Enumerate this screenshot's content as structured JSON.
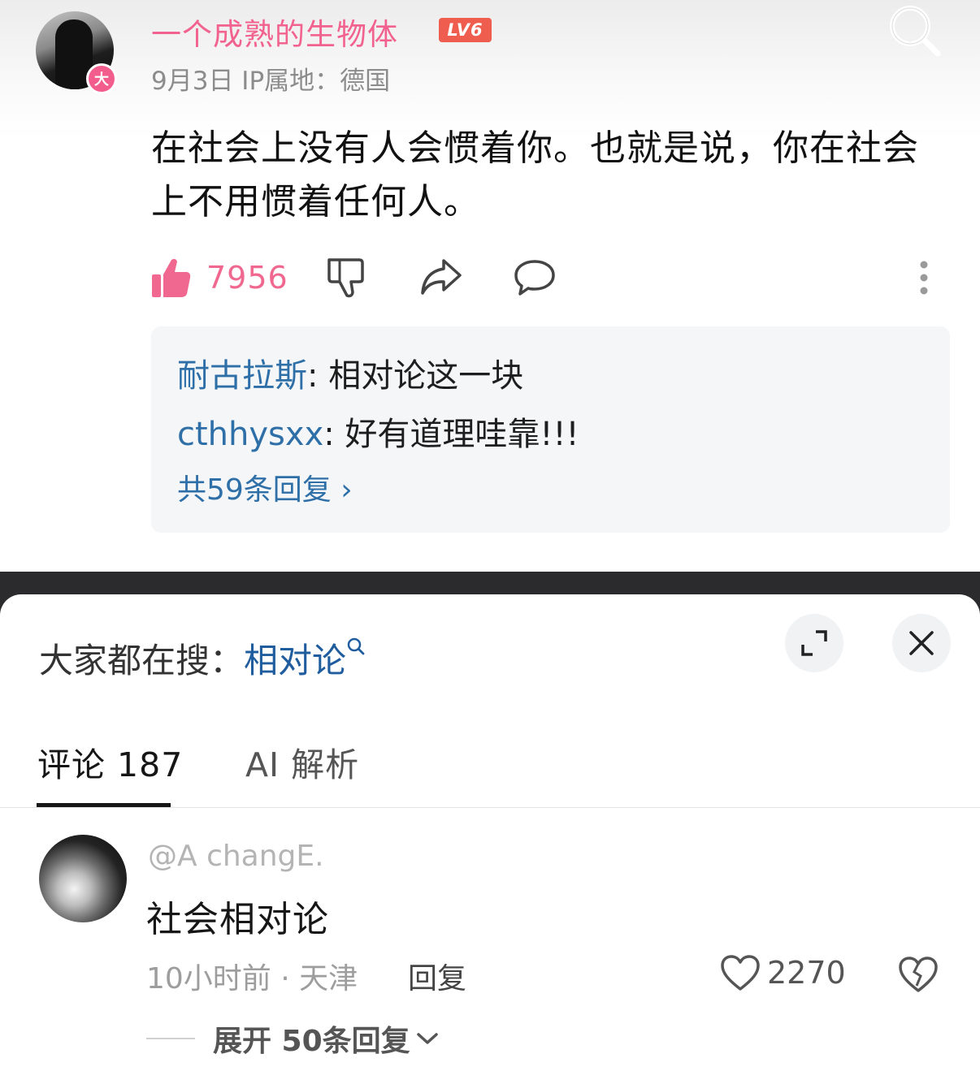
{
  "post": {
    "author": "一个成熟的生物体",
    "level": "LV6",
    "avatar_badge": "大",
    "meta": "9月3日 IP属地：德国",
    "text": "在社会上没有人会惯着你。也就是说，你在社会上不用惯着任何人。",
    "likes": "7956",
    "replies": [
      {
        "user": "耐古拉斯",
        "text": ": 相对论这一块"
      },
      {
        "user": "cthhysxx",
        "text": ": 好有道理哇靠!!!"
      }
    ],
    "more_replies": "共59条回复 ›"
  },
  "sheet": {
    "hot_search_label": "大家都在搜：",
    "hot_search_term": "相对论",
    "tabs": [
      {
        "label": "评论 187",
        "active": true
      },
      {
        "label": "AI 解析",
        "active": false
      }
    ],
    "comment": {
      "user": "@A changE.",
      "text": "社会相对论",
      "meta": "10小时前 · 天津",
      "reply_label": "回复",
      "likes": "2270",
      "expand_label": "展开 50条回复"
    }
  },
  "colors": {
    "author_pink": "#f2628f",
    "level_red": "#ef5d4e",
    "link_blue": "#2e6fa8",
    "hot_term_blue": "#1f5d9e",
    "like_pink": "#f0688f"
  },
  "icons": [
    "search-icon",
    "thumbs-up-icon",
    "thumbs-down-icon",
    "share-icon",
    "comment-icon",
    "more-vertical-icon",
    "search-small-icon",
    "expand-icon",
    "close-icon",
    "heart-icon",
    "broken-heart-icon",
    "chevron-down-icon"
  ]
}
